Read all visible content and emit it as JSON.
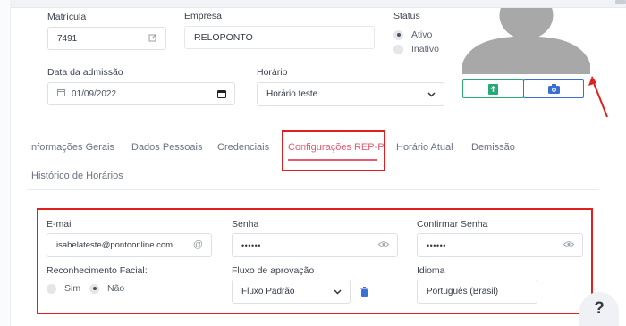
{
  "employee": {
    "matricula": {
      "label": "Matrícula",
      "value": "7491"
    },
    "empresa": {
      "label": "Empresa",
      "value": "RELOPONTO"
    },
    "status": {
      "label": "Status",
      "options": [
        "Ativo",
        "Inativo"
      ],
      "selected": "Ativo"
    },
    "admissao": {
      "label": "Data da admissão",
      "value": "01/09/2022"
    },
    "horario": {
      "label": "Horário",
      "value": "Horário teste"
    }
  },
  "photo": {
    "upload_icon": "upload-file-icon",
    "camera_icon": "camera-icon",
    "accent": "#3b6fd4"
  },
  "tabs": [
    {
      "label": "Informações Gerais"
    },
    {
      "label": "Dados Pessoais"
    },
    {
      "label": "Credenciais"
    },
    {
      "label": "Configurações REP-P",
      "active": true
    },
    {
      "label": "Horário Atual"
    },
    {
      "label": "Demissão"
    },
    {
      "label": "Histórico de Horários"
    }
  ],
  "rep_config": {
    "email": {
      "label": "E-mail",
      "value": "isabelateste@pontoonline.com"
    },
    "senha": {
      "label": "Senha",
      "value": "••••••"
    },
    "confirmar": {
      "label": "Confirmar Senha",
      "value": "••••••"
    },
    "facial": {
      "label": "Reconhecimento Facial:",
      "options": [
        "Sim",
        "Não"
      ],
      "selected": "Não"
    },
    "fluxo": {
      "label": "Fluxo de aprovação",
      "value": "Fluxo Padrão"
    },
    "idioma": {
      "label": "Idioma",
      "value": "Português (Brasil)"
    }
  },
  "help": {
    "label": "?"
  },
  "colors": {
    "highlight": "#e02020",
    "active_tab": "#e35b6f",
    "green": "#2aa876",
    "blue": "#3b6fd4"
  }
}
